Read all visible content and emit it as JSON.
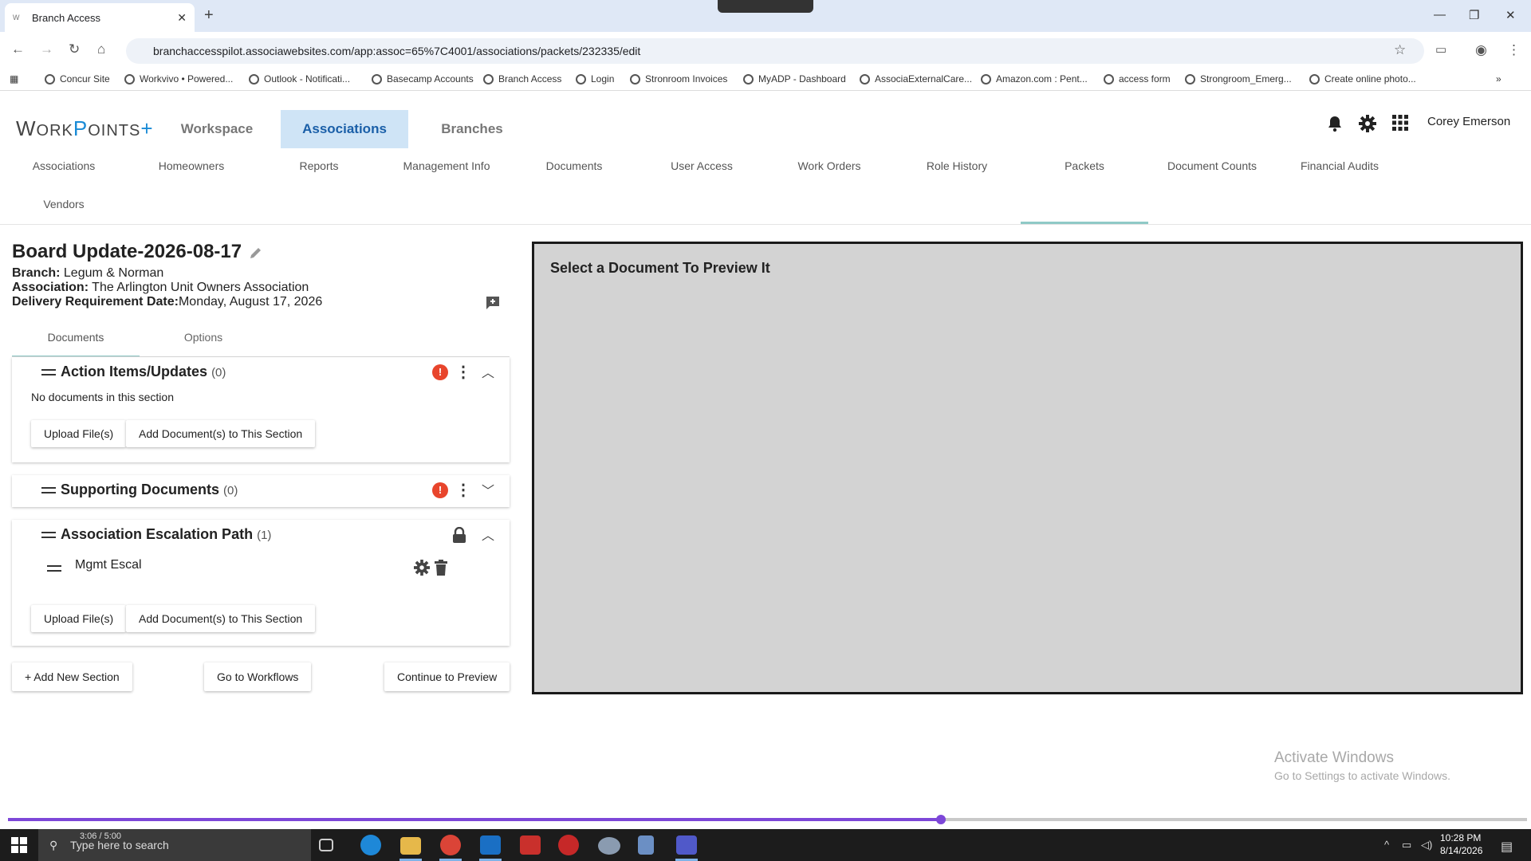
{
  "browser": {
    "tab_title": "Branch Access",
    "url": "branchaccesspilot.associawebsites.com/app:assoc=65%7C4001/associations/packets/232335/edit",
    "bookmarks": [
      {
        "label": "Concur Site"
      },
      {
        "label": "Workvivo • Powered..."
      },
      {
        "label": "Outlook - Notificati..."
      },
      {
        "label": "Basecamp Accounts"
      },
      {
        "label": "Branch Access"
      },
      {
        "label": "Login"
      },
      {
        "label": "Stronroom Invoices"
      },
      {
        "label": "MyADP - Dashboard"
      },
      {
        "label": "AssociaExternalCare..."
      },
      {
        "label": "Amazon.com : Pent..."
      },
      {
        "label": "access form"
      },
      {
        "label": "Strongroom_Emerg..."
      },
      {
        "label": "Create online photo..."
      }
    ]
  },
  "header": {
    "logo": {
      "w": "W",
      "ork": "ORK",
      "o": "P",
      "ints": "OINTS",
      "plus": "+"
    },
    "tabs": [
      {
        "label": "Workspace"
      },
      {
        "label": "Associations"
      },
      {
        "label": "Branches"
      }
    ],
    "user_name": "Corey Emerson"
  },
  "subnav": [
    {
      "label": "Associations"
    },
    {
      "label": "Homeowners"
    },
    {
      "label": "Reports"
    },
    {
      "label": "Management Info"
    },
    {
      "label": "Documents"
    },
    {
      "label": "User Access"
    },
    {
      "label": "Work Orders"
    },
    {
      "label": "Role History"
    },
    {
      "label": "Packets"
    },
    {
      "label": "Document Counts"
    },
    {
      "label": "Financial Audits"
    },
    {
      "label": "Vendors"
    }
  ],
  "packet": {
    "title": "Board Update-2026-08-17",
    "branch_label": "Branch:",
    "branch_value": "Legum & Norman",
    "association_label": "Association:",
    "association_value": "The Arlington Unit Owners Association",
    "delivery_label": "Delivery Requirement Date:",
    "delivery_value": "Monday, August 17, 2026"
  },
  "panel_tabs": {
    "documents": "Documents",
    "options": "Options"
  },
  "sections": [
    {
      "title": "Action Items/Updates",
      "count": "(0)",
      "empty_text": "No documents in this section",
      "upload_label": "Upload File(s)",
      "add_label": "Add Document(s) to This Section"
    },
    {
      "title": "Supporting Documents",
      "count": "(0)"
    },
    {
      "title": "Association Escalation Path",
      "count": "(1)",
      "documents": [
        {
          "name": "Mgmt Escal"
        }
      ],
      "upload_label": "Upload File(s)",
      "add_label": "Add Document(s) to This Section"
    }
  ],
  "actions": {
    "add_section": "+ Add New Section",
    "workflows": "Go to Workflows",
    "continue": "Continue to Preview"
  },
  "preview": {
    "placeholder": "Select a Document To Preview It"
  },
  "watermark": {
    "line1": "Activate Windows",
    "line2": "Go to Settings to activate Windows."
  },
  "video": {
    "time": "3:06 / 5:00",
    "progress": 0.614
  },
  "taskbar": {
    "search_placeholder": "Type here to search",
    "time": "10:28 PM",
    "date": "8/14/2026"
  }
}
